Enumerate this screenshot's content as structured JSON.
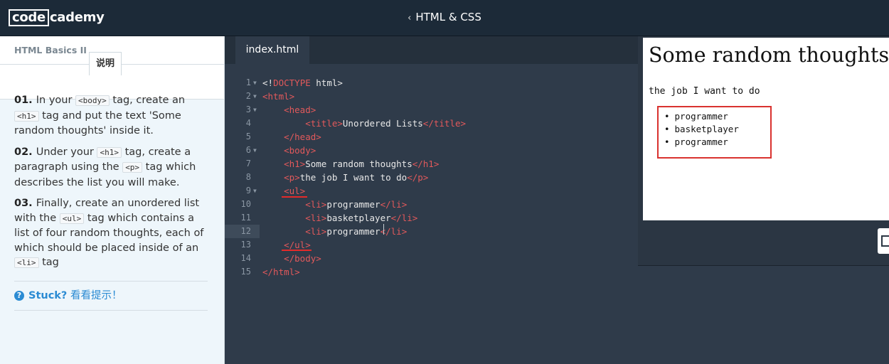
{
  "header": {
    "logo_box": "code",
    "logo_rest": "cademy",
    "course_title": "HTML & CSS"
  },
  "lesson": {
    "title": "HTML Basics II",
    "instructions_tab": "说明",
    "steps": [
      {
        "num": "01.",
        "parts": [
          "In your ",
          "<body>",
          " tag, create an ",
          "<h1>",
          " tag and put the text 'Some random thoughts' inside it."
        ]
      },
      {
        "num": "02.",
        "parts": [
          "Under your ",
          "<h1>",
          " tag, create a paragraph using the ",
          "<p>",
          " tag which describes the list you will make."
        ]
      },
      {
        "num": "03.",
        "parts": [
          "Finally, create an unordered list with the ",
          "<ul>",
          " tag which contains a list of four random thoughts, each of which should be placed inside of an ",
          "<li>",
          " tag"
        ]
      }
    ],
    "stuck_label": "Stuck?",
    "hint_label": "看看提示！"
  },
  "editor": {
    "file_tab": "index.html",
    "lines": [
      {
        "n": "1",
        "fold": true,
        "html": "&lt;!<span class='t'>DOCTYPE</span> html&gt;"
      },
      {
        "n": "2",
        "fold": true,
        "html": "<span class='t'>&lt;html&gt;</span>"
      },
      {
        "n": "3",
        "fold": true,
        "html": "    <span class='t'>&lt;head&gt;</span>"
      },
      {
        "n": "4",
        "fold": false,
        "html": "        <span class='t'>&lt;title&gt;</span>Unordered Lists<span class='t'>&lt;/title&gt;</span>"
      },
      {
        "n": "5",
        "fold": false,
        "html": "    <span class='t'>&lt;/head&gt;</span>"
      },
      {
        "n": "6",
        "fold": true,
        "html": "    <span class='t'>&lt;body&gt;</span>"
      },
      {
        "n": "7",
        "fold": false,
        "html": "    <span class='t'>&lt;h1&gt;</span>Some random thoughts<span class='t'>&lt;/h1&gt;</span>"
      },
      {
        "n": "8",
        "fold": false,
        "html": "    <span class='t'>&lt;p&gt;</span>the job I want to do<span class='t'>&lt;/p&gt;</span>"
      },
      {
        "n": "9",
        "fold": true,
        "html": "    <span class='t'>&lt;ul&gt;</span>"
      },
      {
        "n": "10",
        "fold": false,
        "html": "        <span class='t'>&lt;li&gt;</span>programmer<span class='t'>&lt;/li&gt;</span>"
      },
      {
        "n": "11",
        "fold": false,
        "html": "        <span class='t'>&lt;li&gt;</span>basketplayer<span class='t'>&lt;/li&gt;</span>"
      },
      {
        "n": "12",
        "fold": false,
        "html": "        <span class='t'>&lt;li&gt;</span>programmer<span class='t'>&lt;/li&gt;</span>"
      },
      {
        "n": "13",
        "fold": false,
        "html": "    <span class='t'>&lt;/ul&gt;</span>"
      },
      {
        "n": "14",
        "fold": false,
        "html": "    <span class='t'>&lt;/body&gt;</span>"
      },
      {
        "n": "15",
        "fold": false,
        "html": "<span class='t'>&lt;/html&gt;</span>"
      }
    ],
    "active_line": "12"
  },
  "preview": {
    "h1": "Some random thoughts",
    "p": "the job I want to do",
    "list": [
      "programmer",
      "basketplayer",
      "programmer"
    ]
  },
  "colors": {
    "topbar": "#1c2a38",
    "editor_bg": "#2f3b4a",
    "tag": "#e2595b",
    "highlight": "#d9322f",
    "link": "#2b8bd3"
  }
}
